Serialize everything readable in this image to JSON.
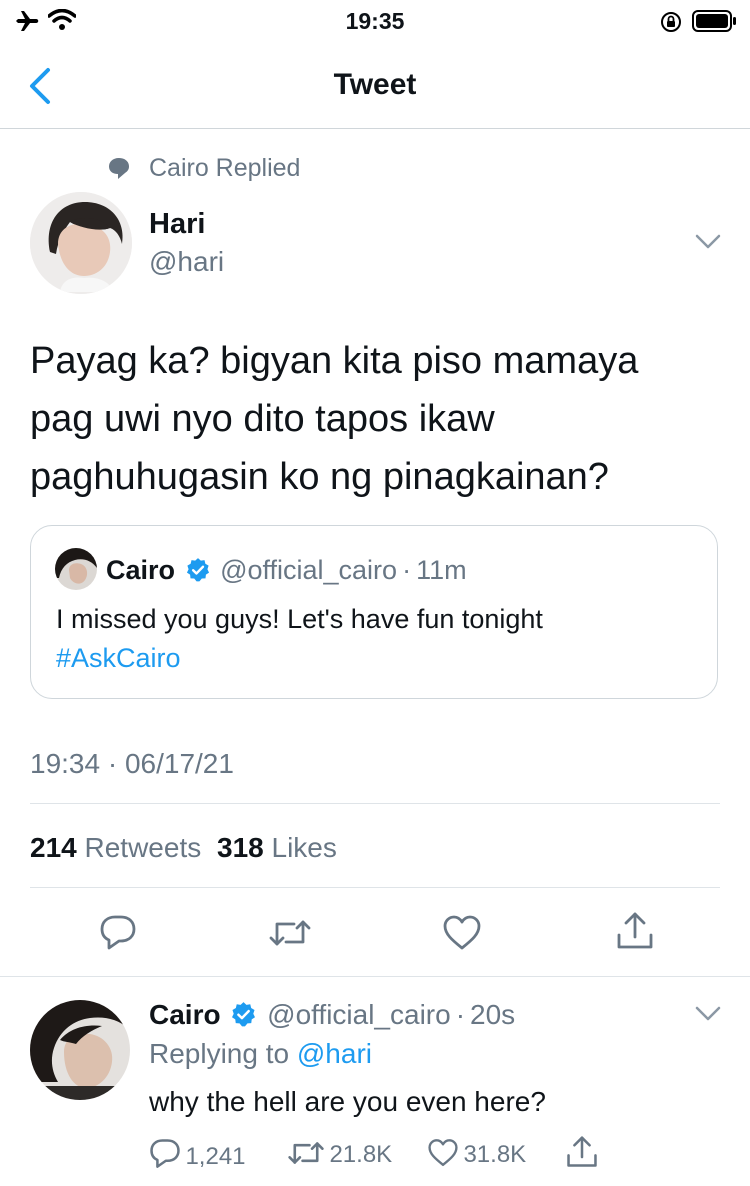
{
  "status": {
    "time": "19:35"
  },
  "nav": {
    "title": "Tweet"
  },
  "context": {
    "label": "Cairo Replied"
  },
  "tweet": {
    "author_name": "Hari",
    "author_handle": "@hari",
    "text_lines": [
      "Payag ka? bigyan kita piso mamaya",
      "pag uwi nyo dito tapos ikaw",
      "paghuhugasin ko ng pinagkainan?"
    ],
    "timestamp": "19:34 · 06/17/21",
    "retweet_count": "214",
    "retweet_label": "Retweets",
    "like_count": "318",
    "like_label": "Likes"
  },
  "quoted": {
    "name": "Cairo",
    "handle": "@official_cairo",
    "sep": "·",
    "time": "11m",
    "text": "I missed you guys! Let's have fun tonight",
    "hashtag": "#AskCairo"
  },
  "reply": {
    "name": "Cairo",
    "handle": "@official_cairo",
    "sep": "·",
    "time": "20s",
    "replying_to_label": "Replying to",
    "replying_to_handle": "@hari",
    "text": "why the hell are you even here?",
    "reply_count": "1,241",
    "retweet_count": "21.8K",
    "like_count": "31.8K"
  },
  "colors": {
    "accent": "#1d9bf0",
    "secondary_text": "#687684",
    "divider": "#dfe4e8"
  },
  "icons": [
    "airplane-icon",
    "wifi-icon",
    "rotation-lock-icon",
    "battery-icon",
    "back-chevron-icon",
    "speech-bubble-icon",
    "more-chevron-icon",
    "verified-badge-icon",
    "reply-icon",
    "retweet-icon",
    "like-icon",
    "share-icon"
  ]
}
